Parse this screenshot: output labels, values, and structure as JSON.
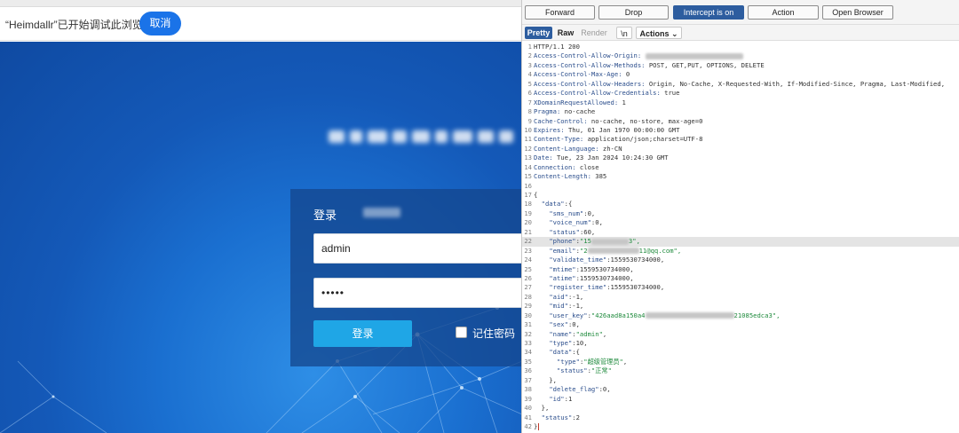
{
  "browser": {
    "debug_message": "“Heimdallr”已开始调试此浏览器",
    "cancel_label": "取消"
  },
  "login": {
    "title": "登录",
    "username_value": "admin",
    "password_value": "•••••",
    "login_button": "登录",
    "remember_label": "记住密码"
  },
  "burp": {
    "toolbar": {
      "forward": "Forward",
      "drop": "Drop",
      "intercept": "Intercept is on",
      "action": "Action",
      "open_browser": "Open Browser"
    },
    "tabs": {
      "pretty": "Pretty",
      "raw": "Raw",
      "render": "Render",
      "newline": "\\n",
      "actions": "Actions ⌄"
    },
    "response_lines": [
      "HTTP/1.1 200",
      "Access-Control-Allow-Origin: ",
      "Access-Control-Allow-Methods: POST, GET,PUT, OPTIONS, DELETE",
      "Access-Control-Max-Age: 0",
      "Access-Control-Allow-Headers: Origin, No-Cache, X-Requested-With, If-Modified-Since, Pragma, Last-Modified,",
      "Access-Control-Allow-Credentials: true",
      "XDomainRequestAllowed: 1",
      "Pragma: no-cache",
      "Cache-Control: no-cache, no-store, max-age=0",
      "Expires: Thu, 01 Jan 1970 00:00:00 GMT",
      "Content-Type: application/json;charset=UTF-8",
      "Content-Language: zh-CN",
      "Date: Tue, 23 Jan 2024 10:24:30 GMT",
      "Connection: close",
      "Content-Length: 385",
      "",
      "{",
      "  \"data\":{",
      "    \"sms_num\":0,",
      "    \"voice_num\":0,",
      "    \"status\":60,",
      "    \"phone\":\"15",
      "    \"email\":\"2",
      "    \"validate_time\":1559530734000,",
      "    \"mtime\":1559530734000,",
      "    \"atime\":1559530734000,",
      "    \"register_time\":1559530734000,",
      "    \"aid\":-1,",
      "    \"mid\":-1,",
      "    \"user_key\":\"426aad8a150a4",
      "    \"sex\":0,",
      "    \"name\":\"admin\",",
      "    \"type\":10,",
      "    \"data\":{",
      "      \"type\":\"超级管理员\",",
      "      \"status\":\"正常\"",
      "    },",
      "    \"delete_flag\":0,",
      "    \"id\":1",
      "  },",
      "  \"status\":2",
      "}"
    ],
    "line_tails": {
      "22": "3\",",
      "23": "11@qq.com\",",
      "30": "21085edca3\","
    }
  }
}
